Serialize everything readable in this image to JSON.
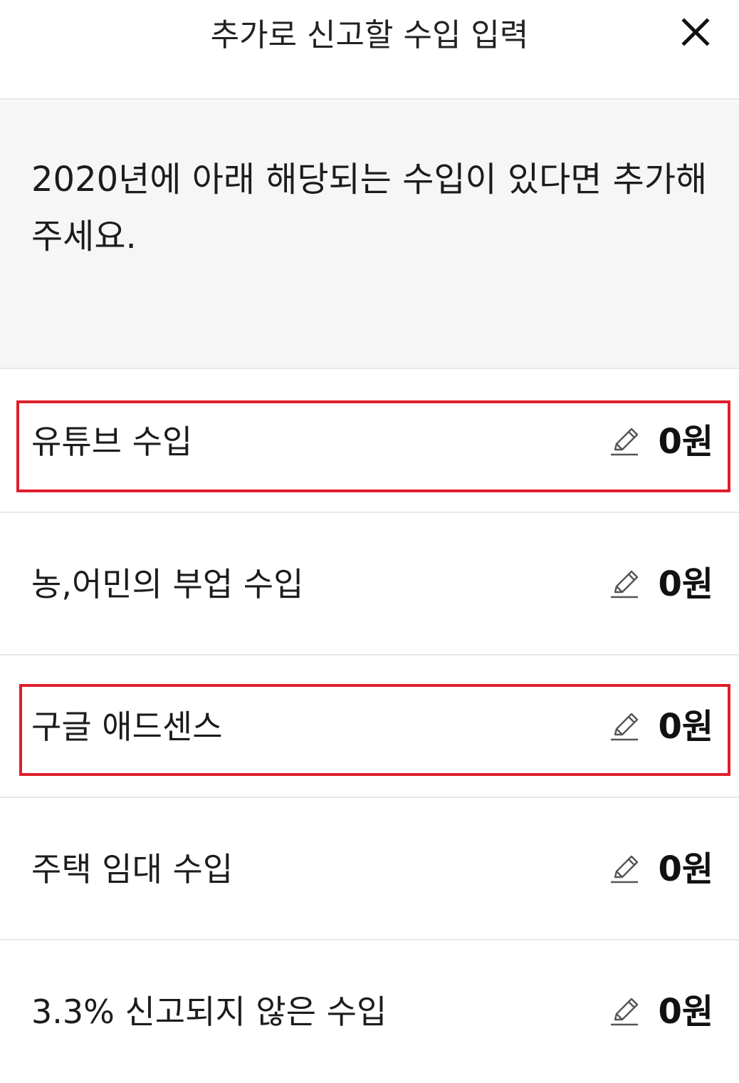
{
  "header": {
    "title": "추가로 신고할 수입 입력",
    "close_label": "닫기"
  },
  "notice": {
    "text": "2020년에 아래 해당되는 수입이 있다면 추가해 주세요."
  },
  "income_items": [
    {
      "label": "유튜브 수입",
      "amount": "0원",
      "highlighted": true
    },
    {
      "label": "농,어민의 부업 수입",
      "amount": "0원",
      "highlighted": false
    },
    {
      "label": "구글 애드센스",
      "amount": "0원",
      "highlighted": true
    },
    {
      "label": "주택 임대 수입",
      "amount": "0원",
      "highlighted": false
    },
    {
      "label": "3.3% 신고되지 않은 수입",
      "amount": "0원",
      "highlighted": false
    }
  ],
  "colors": {
    "highlight": "#e01e2b",
    "notice_bg": "#f6f6f6",
    "divider": "#e8e8e8"
  },
  "icons": {
    "close": "close-icon",
    "edit": "pencil-icon"
  }
}
